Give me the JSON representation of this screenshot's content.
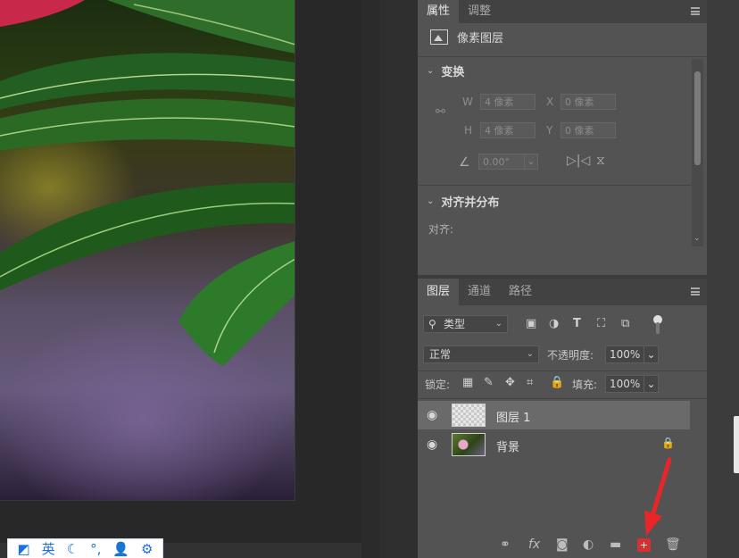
{
  "properties_panel": {
    "tabs": [
      {
        "label": "属性",
        "active": true
      },
      {
        "label": "调整",
        "active": false
      }
    ],
    "layer_type": "像素图层",
    "transform": {
      "title": "变换",
      "w_label": "W",
      "w_value": "4 像素",
      "x_label": "X",
      "x_value": "0 像素",
      "h_label": "H",
      "h_value": "4 像素",
      "y_label": "Y",
      "y_value": "0 像素",
      "angle_value": "0.00°"
    },
    "align": {
      "title": "对齐并分布",
      "label": "对齐:"
    }
  },
  "layers_panel": {
    "tabs": [
      {
        "label": "图层",
        "active": true
      },
      {
        "label": "通道",
        "active": false
      },
      {
        "label": "路径",
        "active": false
      }
    ],
    "filter_type": "类型",
    "blend_mode": "正常",
    "opacity_label": "不透明度:",
    "opacity_value": "100%",
    "lock_label": "锁定:",
    "fill_label": "填充:",
    "fill_value": "100%",
    "layers": [
      {
        "name": "图层 1",
        "selected": true,
        "locked": false
      },
      {
        "name": "背景",
        "selected": false,
        "locked": true
      }
    ],
    "bottom_icons": [
      "link-icon",
      "fx-icon",
      "mask-icon",
      "adjustment-icon",
      "folder-icon",
      "new-layer-icon",
      "trash-icon"
    ]
  },
  "ime_toolbar": {
    "language": "英"
  },
  "colors": {
    "panel_bg": "#535353",
    "tab_bar_bg": "#424242",
    "selected_row": "#6a6a6a",
    "annotation_red": "#e8262a",
    "ime_blue": "#1d6fe0"
  }
}
